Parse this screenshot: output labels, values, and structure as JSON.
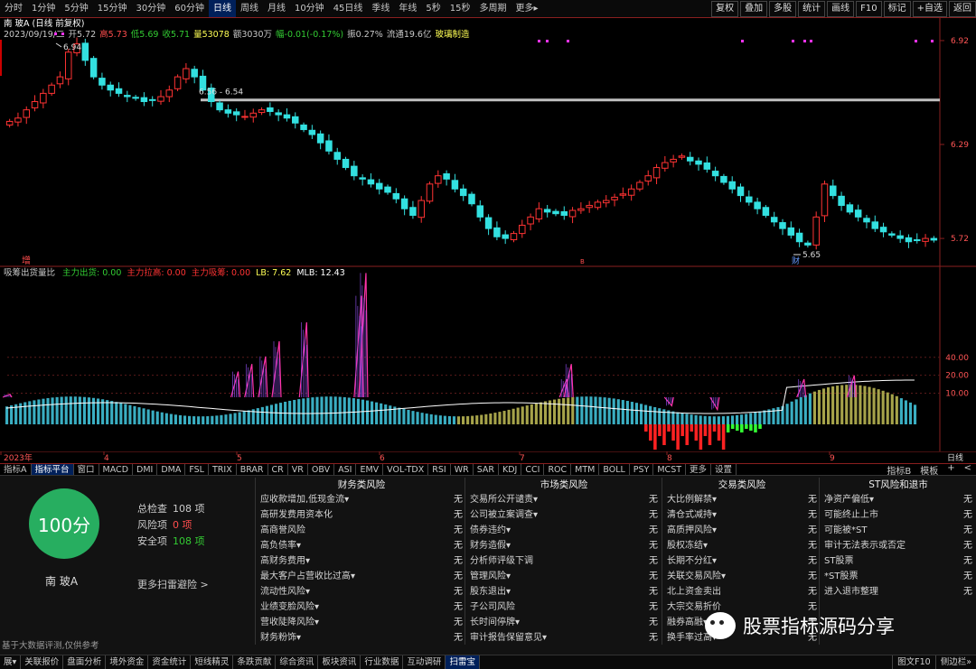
{
  "topbar": {
    "periods": [
      "分时",
      "1分钟",
      "5分钟",
      "15分钟",
      "30分钟",
      "60分钟",
      "日线",
      "周线",
      "月线",
      "10分钟",
      "45日线",
      "季线",
      "年线",
      "5秒",
      "15秒",
      "多周期",
      "更多▸"
    ],
    "active_period": "日线",
    "right_buttons": [
      "复权",
      "叠加",
      "多股",
      "统计",
      "画线",
      "F10",
      "标记",
      "+自选",
      "返回"
    ]
  },
  "stock": {
    "title": "南 玻A (日线 前复权)",
    "info": [
      {
        "t": "2023/09/19/二",
        "c": "#c8c8c8"
      },
      {
        "t": "开5.72",
        "c": "#c8c8c8"
      },
      {
        "t": "高5.73",
        "c": "#ff4d4d"
      },
      {
        "t": "低5.69",
        "c": "#33cc33"
      },
      {
        "t": "收5.71",
        "c": "#33cc33"
      },
      {
        "t": "量53078",
        "c": "#ffff55"
      },
      {
        "t": "额3030万",
        "c": "#c8c8c8"
      },
      {
        "t": "幅-0.01(-0.17%)",
        "c": "#33cc33"
      },
      {
        "t": "振0.27%",
        "c": "#c8c8c8"
      },
      {
        "t": "流通19.6亿",
        "c": "#c8c8c8"
      },
      {
        "t": "玻璃制造",
        "c": "#ffff55"
      }
    ]
  },
  "main_chart": {
    "y_labels": [
      "6.92",
      "6.29",
      "5.72"
    ],
    "hi_label": "6.94",
    "range_label": "6.56 - 6.54",
    "lo_label": "5.65",
    "marker_zeng": "增",
    "marker_cai": "财",
    "marker_b": "B",
    "close_prices": [
      6.43,
      6.45,
      6.5,
      6.55,
      6.6,
      6.65,
      6.7,
      6.85,
      6.9,
      6.8,
      6.7,
      6.65,
      6.62,
      6.6,
      6.58,
      6.57,
      6.55,
      6.56,
      6.58,
      6.62,
      6.7,
      6.75,
      6.7,
      6.62,
      6.55,
      6.5,
      6.48,
      6.47,
      6.46,
      6.48,
      6.5,
      6.49,
      6.47,
      6.45,
      6.42,
      6.38,
      6.35,
      6.3,
      6.25,
      6.2,
      6.15,
      6.1,
      6.08,
      6.05,
      6.02,
      6.0,
      5.96,
      5.9,
      5.86,
      5.95,
      6.05,
      6.1,
      6.08,
      6.02,
      5.98,
      5.93,
      5.85,
      5.78,
      5.73,
      5.72,
      5.75,
      5.8,
      5.85,
      5.9,
      5.88,
      5.87,
      5.86,
      5.89,
      5.9,
      5.92,
      5.94,
      5.95,
      5.97,
      5.99,
      6.02,
      6.06,
      6.1,
      6.15,
      6.18,
      6.2,
      6.22,
      6.19,
      6.17,
      6.14,
      6.1,
      6.06,
      6.02,
      5.98,
      5.94,
      5.9,
      5.86,
      5.82,
      5.78,
      5.74,
      5.7,
      5.68,
      5.85,
      6.05,
      5.98,
      5.92,
      5.88,
      5.85,
      5.82,
      5.78,
      5.76,
      5.74,
      5.72,
      5.7,
      5.71,
      5.72,
      5.71
    ]
  },
  "indicator": {
    "name": "吸筹出货量比",
    "lines": [
      {
        "t": "主力出货: 0.00",
        "c": "#33cc33"
      },
      {
        "t": "主力拉高: 0.00",
        "c": "#ff3333"
      },
      {
        "t": "主力吸筹: 0.00",
        "c": "#ff3333"
      },
      {
        "t": "LB: 7.62",
        "c": "#ffff55"
      },
      {
        "t": "MLB: 12.43",
        "c": "#ffffff"
      }
    ],
    "y_labels": [
      "40.00",
      "20.00",
      "10.00"
    ],
    "spikes": [
      {
        "at": 1,
        "h": 16
      },
      {
        "at": 51,
        "h": 22
      },
      {
        "at": 54,
        "h": 24
      },
      {
        "at": 57,
        "h": 26
      },
      {
        "at": 60,
        "h": 30
      },
      {
        "at": 66,
        "h": 35
      },
      {
        "at": 78,
        "h": 42
      },
      {
        "at": 79,
        "h": 48
      },
      {
        "at": 123,
        "h": 20
      },
      {
        "at": 124,
        "h": 24
      },
      {
        "at": 146,
        "h": 13
      },
      {
        "at": 156,
        "h": 12
      },
      {
        "at": 175,
        "h": 20
      },
      {
        "at": 186,
        "h": 21
      }
    ]
  },
  "x_axis": {
    "labels": [
      "2023年",
      "4",
      "5",
      "6",
      "7",
      "8",
      "9"
    ],
    "period": "日线"
  },
  "indicator_tabs": {
    "items": [
      "指标A",
      "指标平台",
      "窗口",
      "MACD",
      "DMI",
      "DMA",
      "FSL",
      "TRIX",
      "BRAR",
      "CR",
      "VR",
      "OBV",
      "ASI",
      "EMV",
      "VOL-TDX",
      "RSI",
      "WR",
      "SAR",
      "KDJ",
      "CCI",
      "ROC",
      "MTM",
      "BOLL",
      "PSY",
      "MCST",
      "更多",
      "设置"
    ],
    "active": "指标平台",
    "right": [
      "指标B",
      "模板",
      "+",
      "<"
    ]
  },
  "risk": {
    "score": "100分",
    "stock_name": "南 玻A",
    "summary": [
      {
        "label": "总检查",
        "value": "108 项",
        "c": "#cccccc"
      },
      {
        "label": "风险项",
        "value": "0 项",
        "c": "#ff4d4d"
      },
      {
        "label": "安全项",
        "value": "108 项",
        "c": "#33cc33"
      }
    ],
    "more": "更多扫雷避险 >",
    "footnote": "基于大数据评测,仅供参考",
    "columns": [
      {
        "title": "财务类风险",
        "items": [
          [
            "应收款增加,低现金流▾",
            "无"
          ],
          [
            "高研发费用资本化",
            "无"
          ],
          [
            "高商誉风险",
            "无"
          ],
          [
            "高负债率▾",
            "无"
          ],
          [
            "高财务费用▾",
            "无"
          ],
          [
            "最大客户占营收比过高▾",
            "无"
          ],
          [
            "流动性风险▾",
            "无"
          ],
          [
            "业绩变脸风险▾",
            "无"
          ],
          [
            "营收陡降风险▾",
            "无"
          ],
          [
            "财务粉饰▾",
            "无"
          ]
        ]
      },
      {
        "title": "市场类风险",
        "items": [
          [
            "交易所公开谴责▾",
            "无"
          ],
          [
            "公司被立案调查▾",
            "无"
          ],
          [
            "债券违约▾",
            "无"
          ],
          [
            "财务造假▾",
            "无"
          ],
          [
            "分析师评级下调",
            "无"
          ],
          [
            "管理风险▾",
            "无"
          ],
          [
            "股东退出▾",
            "无"
          ],
          [
            "子公司风险",
            "无"
          ],
          [
            "长时间停牌▾",
            "无"
          ],
          [
            "审计报告保留意见▾",
            "无"
          ]
        ]
      },
      {
        "title": "交易类风险",
        "items": [
          [
            "大比例解禁▾",
            "无"
          ],
          [
            "清仓式减持▾",
            "无"
          ],
          [
            "高质押风险▾",
            "无"
          ],
          [
            "股权冻结▾",
            "无"
          ],
          [
            "长期不分红▾",
            "无"
          ],
          [
            "关联交易风险▾",
            "无"
          ],
          [
            "北上资金卖出",
            "无"
          ],
          [
            "大宗交易折价",
            "无"
          ],
          [
            "融券高融▾",
            "无"
          ],
          [
            "换手率过高▾",
            "无"
          ]
        ]
      },
      {
        "title": "ST风险和退市",
        "items": [
          [
            "净资产偏低▾",
            "无"
          ],
          [
            "可能终止上市",
            "无"
          ],
          [
            "可能被*ST",
            "无"
          ],
          [
            "审计无法表示或否定",
            "无"
          ],
          [
            "ST股票",
            "无"
          ],
          [
            "*ST股票",
            "无"
          ],
          [
            "进入退市整理",
            "无"
          ]
        ]
      }
    ]
  },
  "watermark": "股票指标源码分享",
  "bottombar": {
    "items": [
      "展▾",
      "关联报价",
      "盘面分析",
      "境外资金",
      "资金统计",
      "短线精灵",
      "条跌贡献",
      "综合资讯",
      "板块资讯",
      "行业数据",
      "互动调研",
      "扫雷宝"
    ],
    "active": "扫雷宝",
    "right": [
      "图文F10",
      "侧边栏»"
    ]
  },
  "colors": {
    "up": "#ff3333",
    "down": "#33e0e0",
    "accent": "#00205a",
    "score": "#27ae60"
  }
}
